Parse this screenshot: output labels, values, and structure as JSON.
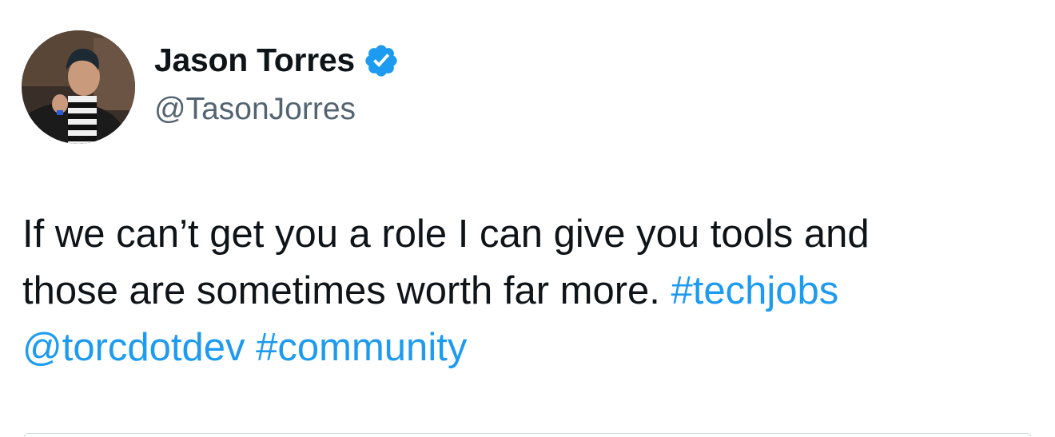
{
  "user": {
    "display_name": "Jason Torres",
    "handle": "@TasonJorres",
    "verified": true,
    "verified_color": "#1d9bf0"
  },
  "tweet": {
    "line1": "If we can’t get you a role I can give you tools and",
    "line2_text": "those are sometimes worth far more.",
    "hashtag_techjobs": "#techjobs",
    "mention_torcdotdev": "@torcdotdev",
    "hashtag_community": "#community"
  },
  "colors": {
    "text": "#0f1419",
    "secondary": "#536471",
    "link": "#1d9bf0"
  }
}
